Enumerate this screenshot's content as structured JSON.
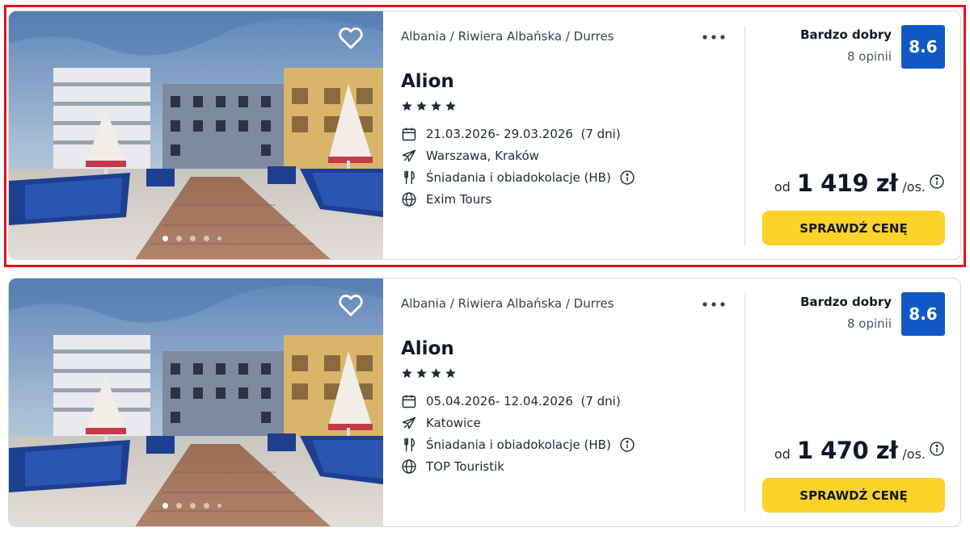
{
  "offers": [
    {
      "location": "Albania / Riwiera Albańska / Durres",
      "name": "Alion",
      "stars": 4,
      "dates": "21.03.2026- 29.03.2026  (7 dni)",
      "departure": "Warszawa, Kraków",
      "board": "Śniadania i obiadokolacje (HB)",
      "operator": "Exim Tours",
      "rating_label": "Bardzo dobry",
      "reviews": "8 opinii",
      "score": "8.6",
      "price_prefix": "od",
      "price": "1 419 zł",
      "price_suffix": "/os.",
      "cta": "SPRAWDŹ CENĘ",
      "photo_index": 1,
      "photo_count": 5
    },
    {
      "location": "Albania / Riwiera Albańska / Durres",
      "name": "Alion",
      "stars": 4,
      "dates": "05.04.2026- 12.04.2026  (7 dni)",
      "departure": "Katowice",
      "board": "Śniadania i obiadokolacje (HB)",
      "operator": "TOP Touristik",
      "rating_label": "Bardzo dobry",
      "reviews": "8 opinii",
      "score": "8.6",
      "price_prefix": "od",
      "price": "1 470 zł",
      "price_suffix": "/os.",
      "cta": "SPRAWDŹ CENĘ",
      "photo_index": 1,
      "photo_count": 5
    }
  ],
  "icons": {
    "favorite": "heart-icon",
    "more": "more-dots-icon",
    "dates": "calendar-icon",
    "departure": "plane-icon",
    "board": "cutlery-icon",
    "operator": "globe-icon",
    "info": "info-icon",
    "star": "star-icon"
  },
  "colors": {
    "highlight": "#e3121b",
    "score_badge": "#1258c4",
    "cta": "#fdd22a"
  }
}
